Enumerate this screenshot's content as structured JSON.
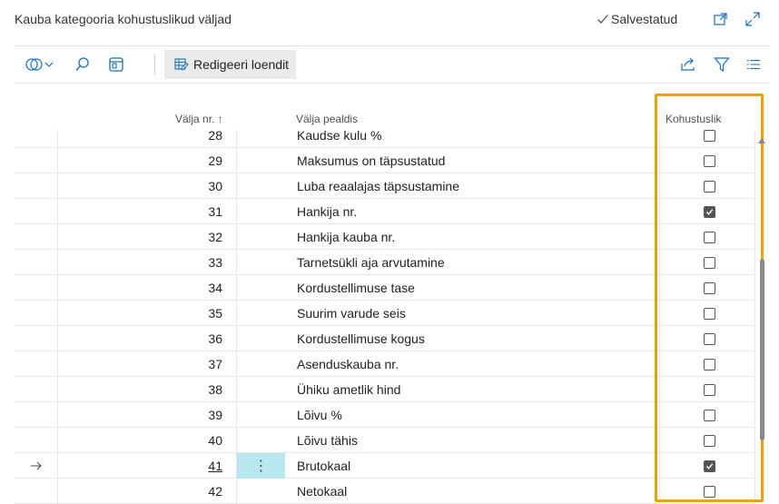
{
  "page": {
    "title": "Kauba kategooria kohustuslikud väljad",
    "saved_status": "Salvestatud"
  },
  "toolbar": {
    "edit_list_label": "Redigeeri loendit"
  },
  "columns": {
    "field_no": "Välja nr. ↑",
    "field_caption": "Välja pealdis",
    "mandatory": "Kohustuslik"
  },
  "rows": [
    {
      "no": "28",
      "caption": "Kaudse kulu %",
      "mandatory": false
    },
    {
      "no": "29",
      "caption": "Maksumus on täpsustatud",
      "mandatory": false
    },
    {
      "no": "30",
      "caption": "Luba reaalajas täpsustamine",
      "mandatory": false
    },
    {
      "no": "31",
      "caption": "Hankija nr.",
      "mandatory": true
    },
    {
      "no": "32",
      "caption": "Hankija kauba nr.",
      "mandatory": false
    },
    {
      "no": "33",
      "caption": "Tarnetsükli aja arvutamine",
      "mandatory": false
    },
    {
      "no": "34",
      "caption": "Kordustellimuse tase",
      "mandatory": false
    },
    {
      "no": "35",
      "caption": "Suurim varude seis",
      "mandatory": false
    },
    {
      "no": "36",
      "caption": "Kordustellimuse kogus",
      "mandatory": false
    },
    {
      "no": "37",
      "caption": "Asenduskauba nr.",
      "mandatory": false
    },
    {
      "no": "38",
      "caption": "Ühiku ametlik hind",
      "mandatory": false
    },
    {
      "no": "39",
      "caption": "Lõivu %",
      "mandatory": false
    },
    {
      "no": "40",
      "caption": "Lõivu tähis",
      "mandatory": false
    },
    {
      "no": "41",
      "caption": "Brutokaal",
      "mandatory": true,
      "current": true
    },
    {
      "no": "42",
      "caption": "Netokaal",
      "mandatory": false
    }
  ],
  "colors": {
    "highlight": "#f0a000",
    "selected_cell": "#b9e8ee"
  }
}
